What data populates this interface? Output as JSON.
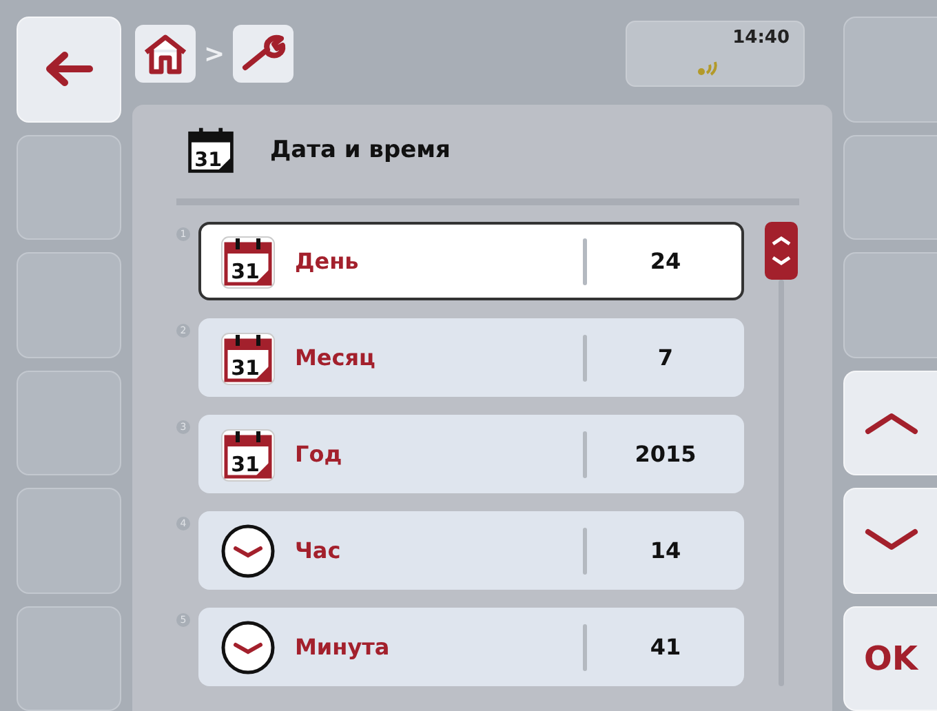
{
  "breadcrumb": {
    "separator": ">"
  },
  "status": {
    "time": "14:40"
  },
  "header": {
    "title": "Дата и время",
    "icon_label": "31"
  },
  "rows": [
    {
      "index": "1",
      "kind": "date",
      "icon_label": "31",
      "label": "День",
      "value": "24",
      "selected": true
    },
    {
      "index": "2",
      "kind": "date",
      "icon_label": "31",
      "label": "Месяц",
      "value": "7",
      "selected": false
    },
    {
      "index": "3",
      "kind": "date",
      "icon_label": "31",
      "label": "Год",
      "value": "2015",
      "selected": false
    },
    {
      "index": "4",
      "kind": "time",
      "label": "Час",
      "value": "14",
      "selected": false
    },
    {
      "index": "5",
      "kind": "time",
      "label": "Минута",
      "value": "41",
      "selected": false
    }
  ],
  "right_buttons": [
    {
      "kind": "empty"
    },
    {
      "kind": "empty"
    },
    {
      "kind": "empty"
    },
    {
      "kind": "up"
    },
    {
      "kind": "down"
    },
    {
      "kind": "text",
      "label": "OK"
    }
  ],
  "left_buttons": [
    {
      "kind": "back"
    },
    {
      "kind": "empty"
    },
    {
      "kind": "empty"
    },
    {
      "kind": "empty"
    },
    {
      "kind": "empty"
    },
    {
      "kind": "empty"
    }
  ]
}
